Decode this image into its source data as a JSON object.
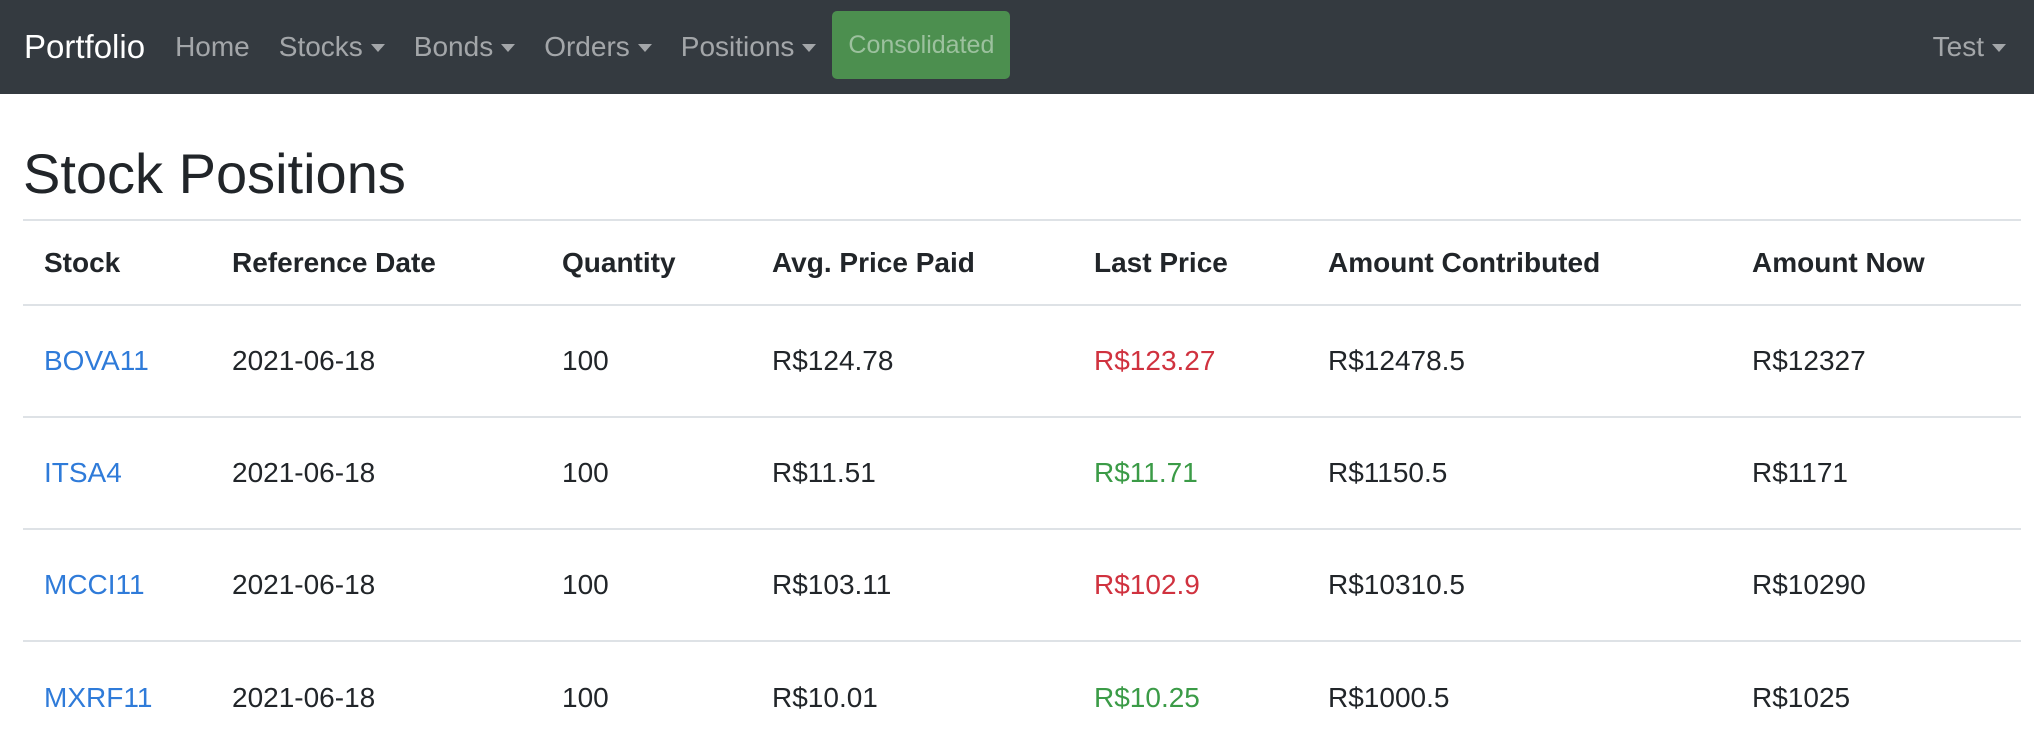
{
  "navbar": {
    "brand": "Portfolio",
    "items": [
      {
        "label": "Home"
      },
      {
        "label": "Stocks"
      },
      {
        "label": "Bonds"
      },
      {
        "label": "Orders"
      },
      {
        "label": "Positions"
      }
    ],
    "consolidated_label": "Consolidated",
    "user_label": "Test"
  },
  "page": {
    "title": "Stock Positions"
  },
  "table": {
    "headers": [
      "Stock",
      "Reference Date",
      "Quantity",
      "Avg. Price Paid",
      "Last Price",
      "Amount Contributed",
      "Amount Now"
    ],
    "rows": [
      {
        "stock": "BOVA11",
        "date": "2021-06-18",
        "quantity": "100",
        "avg_price": "R$124.78",
        "last_price": "R$123.27",
        "contributed": "R$12478.5",
        "now": "R$12327"
      },
      {
        "stock": "ITSA4",
        "date": "2021-06-18",
        "quantity": "100",
        "avg_price": "R$11.51",
        "last_price": "R$11.71",
        "contributed": "R$1150.5",
        "now": "R$1171"
      },
      {
        "stock": "MCCI11",
        "date": "2021-06-18",
        "quantity": "100",
        "avg_price": "R$103.11",
        "last_price": "R$102.9",
        "contributed": "R$10310.5",
        "now": "R$10290"
      },
      {
        "stock": "MXRF11",
        "date": "2021-06-18",
        "quantity": "100",
        "avg_price": "R$10.01",
        "last_price": "R$10.25",
        "contributed": "R$1000.5",
        "now": "R$1025"
      }
    ]
  },
  "colors": {
    "navbar_bg": "#343a40",
    "link": "#2f7bd9",
    "price_down": "#d0323f",
    "price_up": "#3b9b47",
    "consolidated_bg": "#4c8f4f"
  }
}
